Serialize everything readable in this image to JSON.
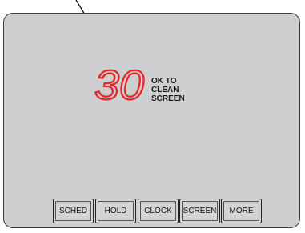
{
  "display": {
    "countdown": "30",
    "message_lines": [
      "OK TO",
      "CLEAN",
      "SCREEN"
    ],
    "countdown_color": "#e5272a",
    "screen_color": "#cdcfd1"
  },
  "buttons": [
    {
      "label": "SCHED"
    },
    {
      "label": "HOLD"
    },
    {
      "label": "CLOCK"
    },
    {
      "label": "SCREEN"
    },
    {
      "label": "MORE"
    }
  ]
}
